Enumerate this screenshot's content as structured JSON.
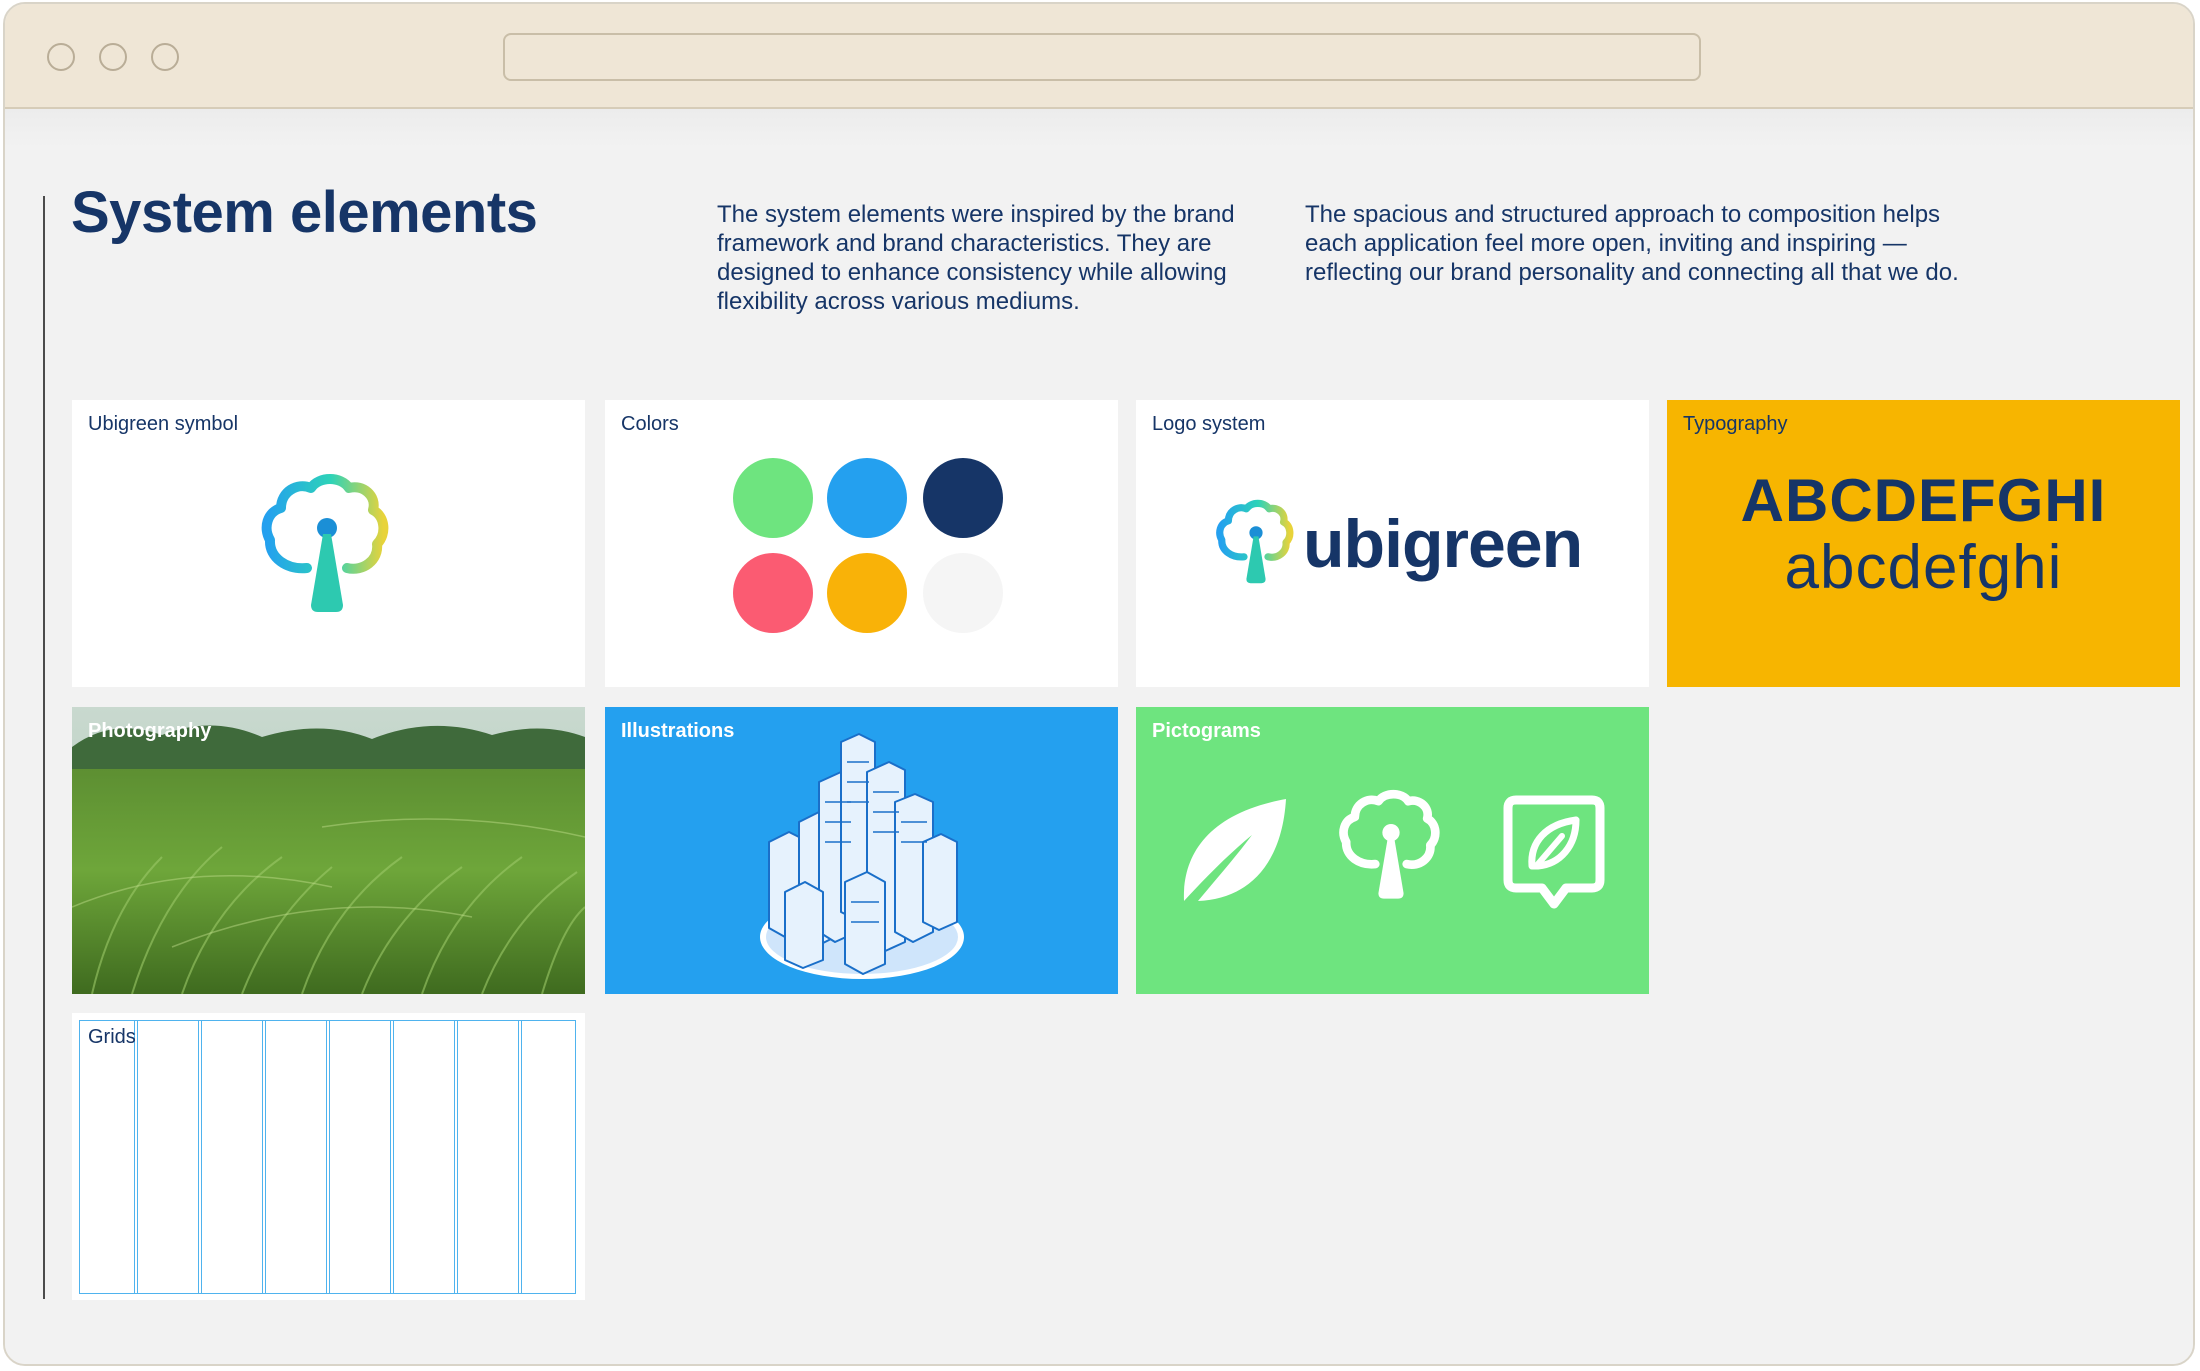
{
  "page": {
    "title": "System elements",
    "intro_left": "The system elements were inspired by the brand framework and brand characteristics. They are designed to enhance consistency while allowing flexibility across various mediums.",
    "intro_right": "The spacious and structured approach to composition helps each application feel more open, inviting and inspiring — reflecting our brand personality and connecting all that we do."
  },
  "cards": {
    "symbol": {
      "label": "Ubigreen symbol",
      "icon": "tree-symbol-icon"
    },
    "colors": {
      "label": "Colors",
      "swatches": [
        "#6ee47f",
        "#24a0ef",
        "#163567",
        "#fb5b72",
        "#f9b208",
        "#f5f5f5"
      ]
    },
    "logo": {
      "label": "Logo system",
      "wordmark": "ubigreen"
    },
    "typography": {
      "label": "Typography",
      "upper": "ABCDEFGHI",
      "lower": "abcdefghi",
      "bg": "#f7b500"
    },
    "photography": {
      "label": "Photography"
    },
    "illustrations": {
      "label": "Illustrations",
      "bg": "#24a0ef"
    },
    "pictograms": {
      "label": "Pictograms",
      "bg": "#6ee47f",
      "icons": [
        "leaf-icon",
        "tree-icon",
        "leaf-chat-icon"
      ]
    },
    "grids": {
      "label": "Grids"
    }
  }
}
